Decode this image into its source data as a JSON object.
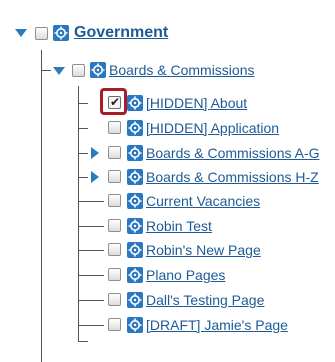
{
  "tree": {
    "root": {
      "label": "Government",
      "expanded": true,
      "checked": false
    },
    "level1": {
      "label": "Boards & Commissions",
      "expanded": true,
      "checked": false
    },
    "children": [
      {
        "label": "[HIDDEN] About",
        "checked": true,
        "expandable": false
      },
      {
        "label": "[HIDDEN] Application",
        "checked": false,
        "expandable": false
      },
      {
        "label": "Boards & Commissions A-G",
        "checked": false,
        "expandable": true
      },
      {
        "label": "Boards & Commissions H-Z",
        "checked": false,
        "expandable": true
      },
      {
        "label": "Current Vacancies",
        "checked": false,
        "expandable": false
      },
      {
        "label": "Robin Test",
        "checked": false,
        "expandable": false
      },
      {
        "label": "Robin's New Page",
        "checked": false,
        "expandable": false
      },
      {
        "label": "Plano Pages",
        "checked": false,
        "expandable": false
      },
      {
        "label": "Dall's Testing Page",
        "checked": false,
        "expandable": false
      },
      {
        "label": "[DRAFT] Jamie's Page",
        "checked": false,
        "expandable": false
      }
    ]
  },
  "colors": {
    "link": "#1e5b96",
    "icon": "#2b78c2",
    "expander": "#2b7bb9",
    "focus": "#a71d2a"
  }
}
